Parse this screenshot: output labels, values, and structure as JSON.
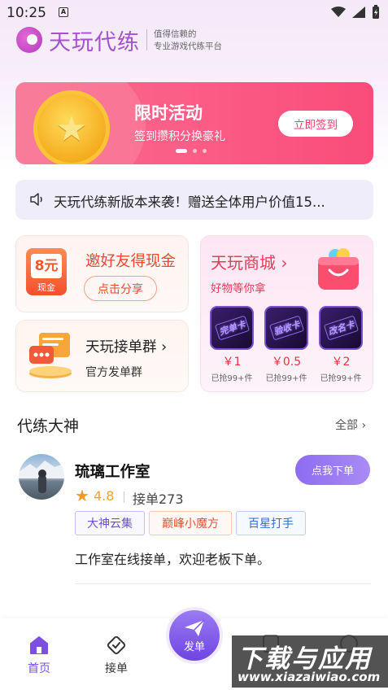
{
  "status_bar": {
    "time": "10:25",
    "indicator": "A"
  },
  "header": {
    "brand": "天玩代练",
    "slogan_line1": "值得信赖的",
    "slogan_line2": "专业游戏代练平台"
  },
  "banner": {
    "title": "限时活动",
    "subtitle": "签到攒积分换豪礼",
    "button": "立即签到",
    "page_count": 3,
    "active_page": 1
  },
  "notice": {
    "text": "天玩代练新版本来袭！赠送全体用户价值15..."
  },
  "invite_card": {
    "coupon_value": "8元",
    "coupon_label": "现金",
    "title": "邀好友得现金",
    "button": "点击分享"
  },
  "group_card": {
    "title": "天玩接单群",
    "subtitle": "官方发单群"
  },
  "mall_card": {
    "title": "天玩商城",
    "subtitle": "好物等你拿",
    "products": [
      {
        "image_text": "完单卡",
        "price": "￥1",
        "sold": "已抢99+件"
      },
      {
        "image_text": "验收卡",
        "price": "￥0.5",
        "sold": "已抢99+件"
      },
      {
        "image_text": "改名卡",
        "price": "￥2",
        "sold": "已抢99+件"
      }
    ]
  },
  "section": {
    "title": "代练大神",
    "more": "全部"
  },
  "studio": {
    "name": "琉璃工作室",
    "rating": "4.8",
    "orders": "接单273",
    "button": "点我下单",
    "tags": [
      "大神云集",
      "巅峰小魔方",
      "百星打手"
    ],
    "description": "工作室在线接单，欢迎老板下单。"
  },
  "bottom_nav": {
    "home": "首页",
    "orders": "接单",
    "publish": "发单"
  },
  "watermark": {
    "title": "下载与应用",
    "url": "www.xiazaiwiao.com"
  },
  "colors": {
    "brand_purple": "#a552cf",
    "banner_pink": "#f94c7a",
    "nav_active": "#7b4fe0",
    "accent_red": "#e5343e"
  }
}
